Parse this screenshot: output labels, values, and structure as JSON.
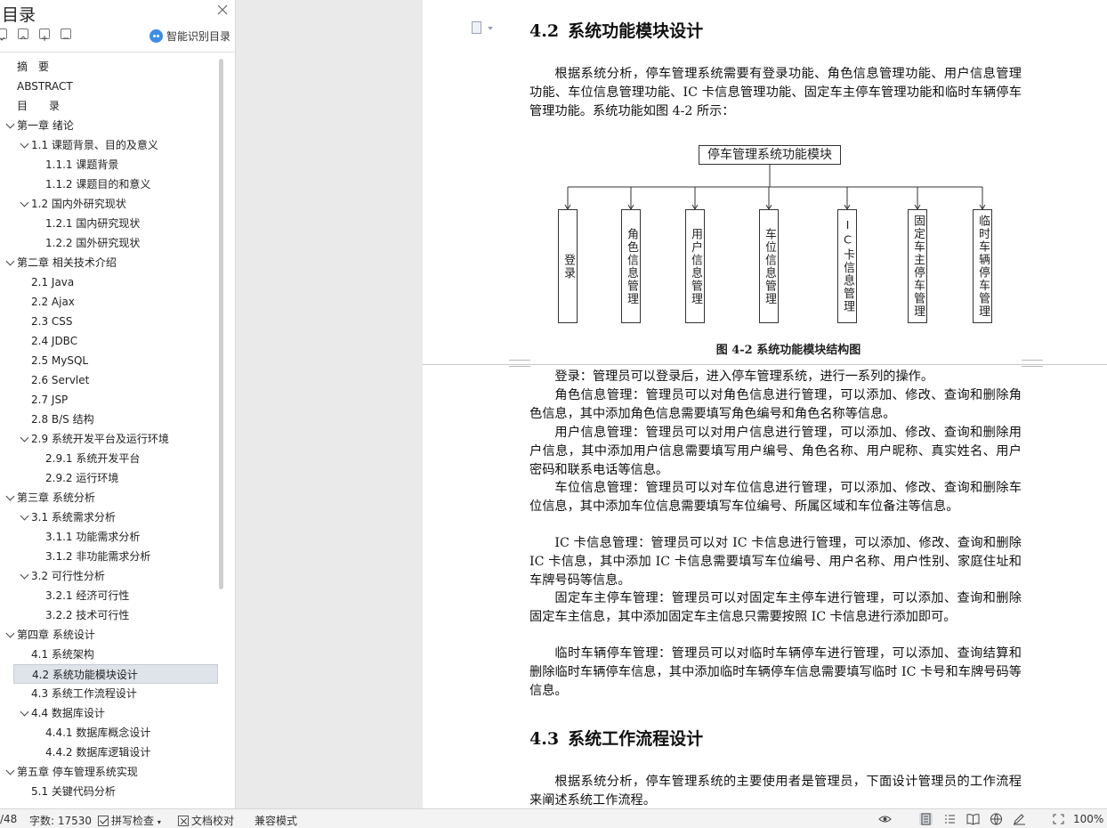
{
  "sidebar": {
    "title": "目录",
    "smart_toc_label": "智能识别目录",
    "toc": [
      {
        "label": "摘　要",
        "level": 1,
        "expandable": false
      },
      {
        "label": "ABSTRACT",
        "level": 1,
        "expandable": false
      },
      {
        "label": "目　　录",
        "level": 1,
        "expandable": false
      },
      {
        "label": "第一章 绪论",
        "level": 1,
        "expandable": true
      },
      {
        "label": "1.1 课题背景、目的及意义",
        "level": 2,
        "expandable": true
      },
      {
        "label": "1.1.1 课题背景",
        "level": 3,
        "expandable": false
      },
      {
        "label": "1.1.2 课题目的和意义",
        "level": 3,
        "expandable": false
      },
      {
        "label": "1.2 国内外研究现状",
        "level": 2,
        "expandable": true
      },
      {
        "label": "1.2.1 国内研究现状",
        "level": 3,
        "expandable": false
      },
      {
        "label": "1.2.2 国外研究现状",
        "level": 3,
        "expandable": false
      },
      {
        "label": "第二章 相关技术介绍",
        "level": 1,
        "expandable": true
      },
      {
        "label": "2.1 Java",
        "level": 2,
        "expandable": false
      },
      {
        "label": "2.2 Ajax",
        "level": 2,
        "expandable": false
      },
      {
        "label": "2.3 CSS",
        "level": 2,
        "expandable": false
      },
      {
        "label": "2.4 JDBC",
        "level": 2,
        "expandable": false
      },
      {
        "label": "2.5 MySQL",
        "level": 2,
        "expandable": false
      },
      {
        "label": "2.6 Servlet",
        "level": 2,
        "expandable": false
      },
      {
        "label": "2.7 JSP",
        "level": 2,
        "expandable": false
      },
      {
        "label": "2.8 B/S 结构",
        "level": 2,
        "expandable": false
      },
      {
        "label": "2.9 系统开发平台及运行环境",
        "level": 2,
        "expandable": true
      },
      {
        "label": "2.9.1 系统开发平台",
        "level": 3,
        "expandable": false
      },
      {
        "label": "2.9.2 运行环境",
        "level": 3,
        "expandable": false
      },
      {
        "label": "第三章 系统分析",
        "level": 1,
        "expandable": true
      },
      {
        "label": "3.1 系统需求分析",
        "level": 2,
        "expandable": true
      },
      {
        "label": "3.1.1 功能需求分析",
        "level": 3,
        "expandable": false
      },
      {
        "label": "3.1.2 非功能需求分析",
        "level": 3,
        "expandable": false
      },
      {
        "label": "3.2 可行性分析",
        "level": 2,
        "expandable": true
      },
      {
        "label": "3.2.1 经济可行性",
        "level": 3,
        "expandable": false
      },
      {
        "label": "3.2.2 技术可行性",
        "level": 3,
        "expandable": false
      },
      {
        "label": "第四章 系统设计",
        "level": 1,
        "expandable": true
      },
      {
        "label": "4.1 系统架构",
        "level": 2,
        "expandable": false
      },
      {
        "label": "4.2 系统功能模块设计",
        "level": 2,
        "expandable": false,
        "active": true
      },
      {
        "label": "4.3 系统工作流程设计",
        "level": 2,
        "expandable": false
      },
      {
        "label": "4.4 数据库设计",
        "level": 2,
        "expandable": true
      },
      {
        "label": "4.4.1 数据库概念设计",
        "level": 3,
        "expandable": false
      },
      {
        "label": "4.4.2 数据库逻辑设计",
        "level": 3,
        "expandable": false
      },
      {
        "label": "第五章 停车管理系统实现",
        "level": 1,
        "expandable": true
      },
      {
        "label": "5.1 关键代码分析",
        "level": 2,
        "expandable": false
      }
    ]
  },
  "document": {
    "section_4_2": {
      "number": "4.2",
      "title": "系统功能模块设计"
    },
    "intro": "根据系统分析，停车管理系统需要有登录功能、角色信息管理功能、用户信息管理功能、车位信息管理功能、IC 卡信息管理功能、固定车主停车管理功能和临时车辆停车管理功能。系统功能如图 4-2 所示：",
    "diagram": {
      "root": "停车管理系统功能模块",
      "leaves": [
        "登录",
        "角色信息管理",
        "用户信息管理",
        "车位信息管理",
        "IC卡信息管理",
        "固定车主停车管理",
        "临时车辆停车管理"
      ]
    },
    "figure_caption": "图 4-2  系统功能模块结构图",
    "paragraphs": [
      "登录：管理员可以登录后，进入停车管理系统，进行一系列的操作。",
      "角色信息管理：管理员可以对角色信息进行管理，可以添加、修改、查询和删除角色信息，其中添加角色信息需要填写角色编号和角色名称等信息。",
      "用户信息管理：管理员可以对用户信息进行管理，可以添加、修改、查询和删除用户信息，其中添加用户信息需要填写用户编号、角色名称、用户昵称、真实姓名、用户密码和联系电话等信息。",
      "车位信息管理：管理员可以对车位信息进行管理，可以添加、修改、查询和删除车位信息，其中添加车位信息需要填写车位编号、所属区域和车位备注等信息。",
      "IC 卡信息管理：管理员可以对 IC 卡信息进行管理，可以添加、修改、查询和删除 IC 卡信息，其中添加 IC 卡信息需要填写车位编号、用户名称、用户性别、家庭住址和车牌号码等信息。",
      "固定车主停车管理：管理员可以对固定车主停车进行管理，可以添加、查询和删除固定车主信息，其中添加固定车主信息只需要按照 IC 卡信息进行添加即可。",
      "临时车辆停车管理：管理员可以对临时车辆停车进行管理，可以添加、查询结算和删除临时车辆停车信息，其中添加临时车辆停车信息需要填写临时 IC 卡号和车牌号码等信息。"
    ],
    "section_4_3": {
      "number": "4.3",
      "title": "系统工作流程设计"
    },
    "outro": "根据系统分析，停车管理系统的主要使用者是管理员，下面设计管理员的工作流程来阐述系统工作流程。"
  },
  "status": {
    "page": "/48",
    "word_count": "字数: 17530",
    "spell_check": "拼写检查",
    "proofread": "文档校对",
    "compat_mode": "兼容模式",
    "zoom": "100%"
  }
}
